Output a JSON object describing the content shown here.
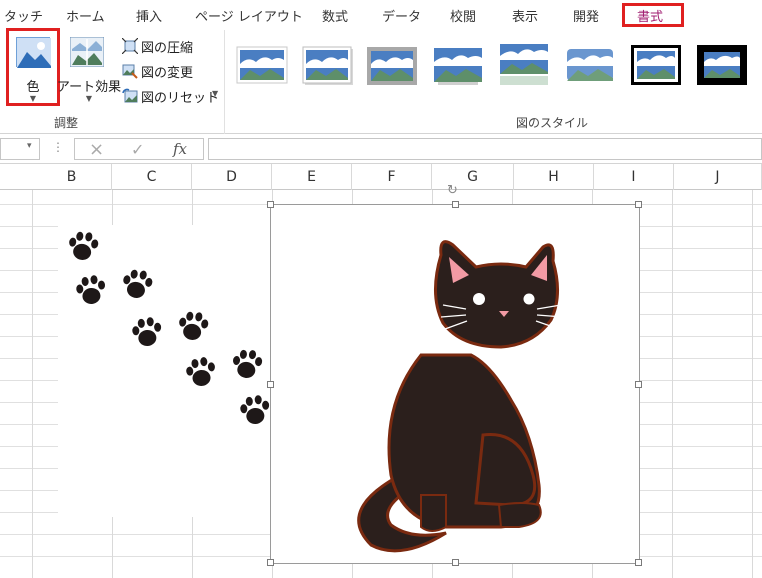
{
  "tabs": [
    {
      "label": "タッチ",
      "active": false
    },
    {
      "label": "ホーム",
      "active": false
    },
    {
      "label": "挿入",
      "active": false
    },
    {
      "label": "ページ レイアウト",
      "active": false
    },
    {
      "label": "数式",
      "active": false
    },
    {
      "label": "データ",
      "active": false
    },
    {
      "label": "校閲",
      "active": false
    },
    {
      "label": "表示",
      "active": false
    },
    {
      "label": "開発",
      "active": false
    },
    {
      "label": "書式",
      "active": true
    }
  ],
  "ribbon": {
    "adjust_group": {
      "color_label": "色",
      "art_effects_label": "アート効果",
      "compress_label": "図の圧縮",
      "change_label": "図の変更",
      "reset_label": "図のリセット",
      "group_label": "調整"
    },
    "styles_group": {
      "group_label": "図のスタイル"
    }
  },
  "formula_bar": {
    "cancel_icon": "×",
    "enter_icon": "✓",
    "fx_label": "fx",
    "name_caret": "▾",
    "dots": "⋮"
  },
  "columns": [
    "B",
    "C",
    "D",
    "E",
    "F",
    "G",
    "H",
    "I",
    "J"
  ],
  "colors": {
    "highlight": "#e02020",
    "cat_body": "#2b1f1c",
    "cat_outline": "#7a2a10",
    "paw": "#1e1818"
  },
  "icons": {
    "color": "picture-color-icon",
    "art": "art-effects-icon",
    "compress": "compress-picture-icon",
    "change": "change-picture-icon",
    "reset": "reset-picture-icon"
  }
}
